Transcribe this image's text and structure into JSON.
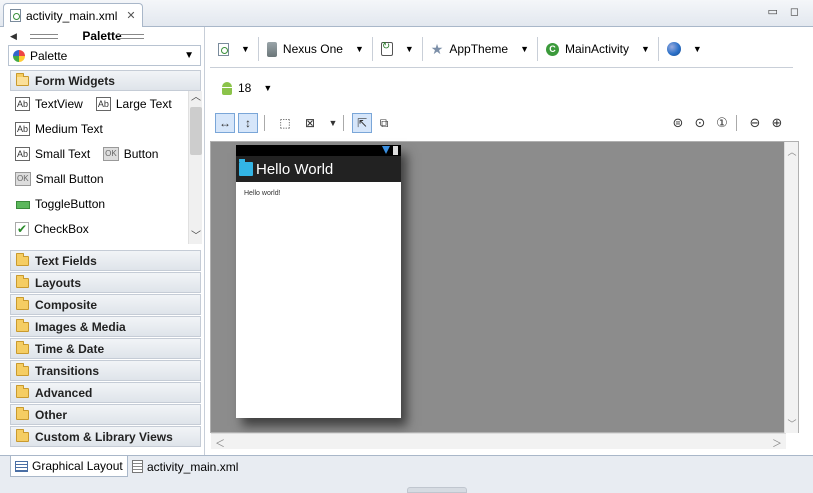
{
  "editor_tab": {
    "label": "activity_main.xml",
    "close": "✕"
  },
  "window": {
    "minimize": "▭",
    "maximize": "◻"
  },
  "palette": {
    "title": "Palette",
    "selector": "Palette",
    "active_category": "Form Widgets",
    "widgets": [
      [
        {
          "icon": "Ab",
          "label": "TextView"
        },
        {
          "icon": "Ab",
          "label": "Large Text"
        }
      ],
      [
        {
          "icon": "Ab",
          "label": "Medium Text"
        }
      ],
      [
        {
          "icon": "Ab",
          "label": "Small Text"
        },
        {
          "icon": "OK",
          "label": "Button"
        }
      ],
      [
        {
          "icon": "OK",
          "label": "Small Button"
        }
      ],
      [
        {
          "icon": "",
          "label": "ToggleButton"
        }
      ],
      [
        {
          "icon": "✔",
          "label": "CheckBox"
        }
      ]
    ],
    "categories": [
      "Text Fields",
      "Layouts",
      "Composite",
      "Images & Media",
      "Time & Date",
      "Transitions",
      "Advanced",
      "Other",
      "Custom & Library Views"
    ]
  },
  "config": {
    "device": "Nexus One",
    "theme": "AppTheme",
    "activity": "MainActivity",
    "activity_icon_letter": "C",
    "api_level": "18"
  },
  "preview": {
    "title": "Hello World",
    "content": "Hello world!"
  },
  "bottom_tabs": {
    "graphical": "Graphical Layout",
    "xml": "activity_main.xml"
  },
  "colors": {
    "canvas": "#8c8c8c",
    "action_bar": "#222222",
    "holo_blue": "#33b5e5"
  }
}
